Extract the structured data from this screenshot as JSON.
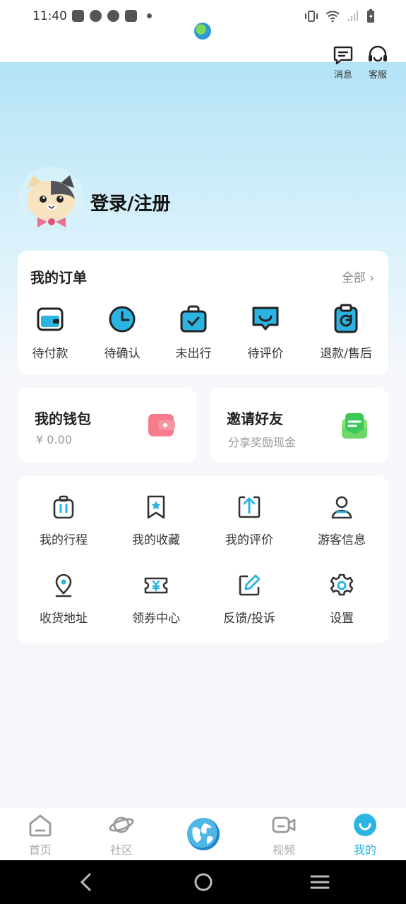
{
  "status_bar": {
    "time": "11:40"
  },
  "header": {
    "message_label": "消息",
    "service_label": "客服"
  },
  "profile": {
    "login_label": "登录/注册"
  },
  "orders": {
    "title": "我的订单",
    "all_label": "全部",
    "items": [
      {
        "label": "待付款",
        "icon": "wallet-card-icon"
      },
      {
        "label": "待确认",
        "icon": "clock-icon"
      },
      {
        "label": "未出行",
        "icon": "suitcase-check-icon"
      },
      {
        "label": "待评价",
        "icon": "comment-icon"
      },
      {
        "label": "退款/售后",
        "icon": "refund-clipboard-icon"
      }
    ]
  },
  "wallet": {
    "title": "我的钱包",
    "balance": "¥ 0.00"
  },
  "invite": {
    "title": "邀请好友",
    "subtitle": "分享奖励现金"
  },
  "tools": {
    "items": [
      {
        "label": "我的行程",
        "icon": "luggage-icon"
      },
      {
        "label": "我的收藏",
        "icon": "bookmark-star-icon"
      },
      {
        "label": "我的评价",
        "icon": "upload-square-icon"
      },
      {
        "label": "游客信息",
        "icon": "person-icon"
      },
      {
        "label": "收货地址",
        "icon": "location-pin-icon"
      },
      {
        "label": "领券中心",
        "icon": "coupon-icon"
      },
      {
        "label": "反馈/投诉",
        "icon": "edit-icon"
      },
      {
        "label": "设置",
        "icon": "gear-icon"
      }
    ]
  },
  "tabbar": {
    "items": [
      {
        "label": "首页",
        "icon": "home-icon"
      },
      {
        "label": "社区",
        "icon": "planet-icon"
      },
      {
        "label": "",
        "icon": "globe-icon"
      },
      {
        "label": "视频",
        "icon": "video-camera-icon"
      },
      {
        "label": "我的",
        "icon": "smile-icon"
      }
    ],
    "active_color": "#2bb4e2"
  },
  "colors": {
    "accent": "#2bb4e2",
    "hero_top": "#b3e3f6"
  }
}
